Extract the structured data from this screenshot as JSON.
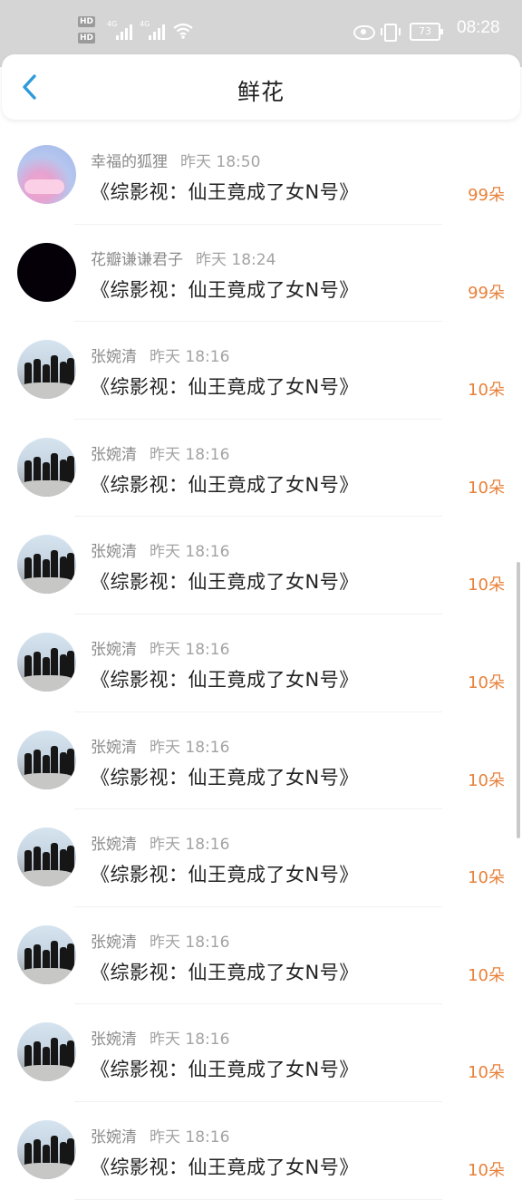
{
  "status_bar": {
    "time": "08:28",
    "battery": "73",
    "hd_label": "HD",
    "sim1": "1",
    "sim2": "2",
    "net_type": "4G"
  },
  "nav": {
    "title": "鲜花",
    "back_icon": "chevron-left-icon"
  },
  "items": [
    {
      "sender": "幸福的狐狸",
      "time": "昨天 18:50",
      "book": "《综影视：仙王竟成了女N号》",
      "count": "99朵",
      "avatar": "fox"
    },
    {
      "sender": "花瓣谦谦君子",
      "time": "昨天 18:24",
      "book": "《综影视：仙王竟成了女N号》",
      "count": "99朵",
      "avatar": "black"
    },
    {
      "sender": "张婉清",
      "time": "昨天 18:16",
      "book": "《综影视：仙王竟成了女N号》",
      "count": "10朵",
      "avatar": "group"
    },
    {
      "sender": "张婉清",
      "time": "昨天 18:16",
      "book": "《综影视：仙王竟成了女N号》",
      "count": "10朵",
      "avatar": "group"
    },
    {
      "sender": "张婉清",
      "time": "昨天 18:16",
      "book": "《综影视：仙王竟成了女N号》",
      "count": "10朵",
      "avatar": "group"
    },
    {
      "sender": "张婉清",
      "time": "昨天 18:16",
      "book": "《综影视：仙王竟成了女N号》",
      "count": "10朵",
      "avatar": "group"
    },
    {
      "sender": "张婉清",
      "time": "昨天 18:16",
      "book": "《综影视：仙王竟成了女N号》",
      "count": "10朵",
      "avatar": "group"
    },
    {
      "sender": "张婉清",
      "time": "昨天 18:16",
      "book": "《综影视：仙王竟成了女N号》",
      "count": "10朵",
      "avatar": "group"
    },
    {
      "sender": "张婉清",
      "time": "昨天 18:16",
      "book": "《综影视：仙王竟成了女N号》",
      "count": "10朵",
      "avatar": "group"
    },
    {
      "sender": "张婉清",
      "time": "昨天 18:16",
      "book": "《综影视：仙王竟成了女N号》",
      "count": "10朵",
      "avatar": "group"
    },
    {
      "sender": "张婉清",
      "time": "昨天 18:16",
      "book": "《综影视：仙王竟成了女N号》",
      "count": "10朵",
      "avatar": "group"
    }
  ],
  "colors": {
    "accent_back": "#2f9bdc",
    "count": "#e8813a",
    "status_bar_bg": "#d5d5d5"
  }
}
